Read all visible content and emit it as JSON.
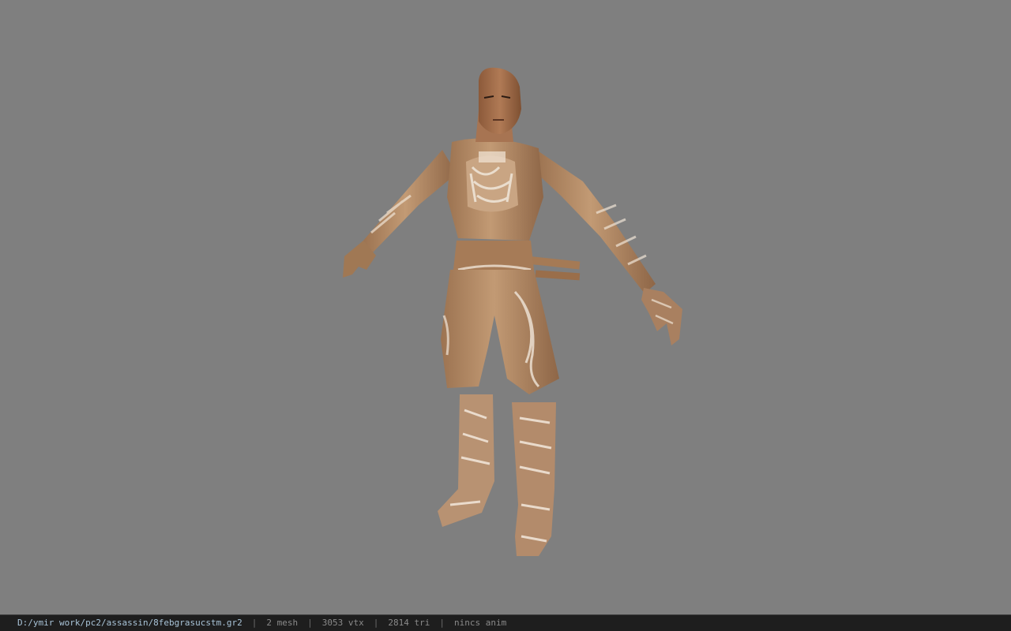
{
  "viewport": {
    "background_color": "#7f7f7f",
    "model": {
      "subject": "assassin character model in T-pose",
      "skin_color": "#b07a55",
      "outfit_color": "#b88e68",
      "outfit_pattern_color": "#f0e6da"
    }
  },
  "statusbar": {
    "file_path": "D:/ymir work/pc2/assassin/8febgrasucstm.gr2",
    "separator": "|",
    "mesh_count": "2 mesh",
    "vertex_count": "3053 vtx",
    "triangle_count": "2814 tri",
    "animation": "nincs anim"
  }
}
